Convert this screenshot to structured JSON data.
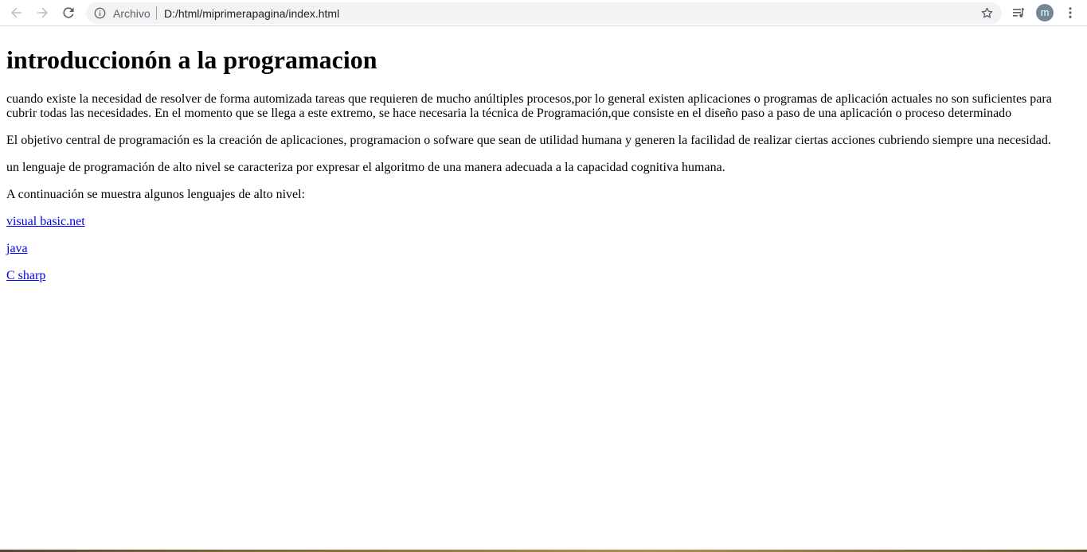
{
  "browser": {
    "address_scheme_label": "Archivo",
    "url": "D:/html/miprimerapagina/index.html",
    "profile_initial": "m",
    "icons": {
      "back": "arrow-left-icon",
      "forward": "arrow-right-icon",
      "reload": "reload-icon",
      "info": "info-icon",
      "bookmark": "star-icon",
      "media": "media-queue-icon",
      "menu": "kebab-menu-icon"
    },
    "colors": {
      "omnibox_bg": "#f1f3f4",
      "avatar_bg": "#6f8a96",
      "link": "#0000ee"
    }
  },
  "page": {
    "title": "introduccionón a la programacion",
    "paragraphs": [
      "cuando existe la necesidad de resolver de forma automizada tareas que requieren de mucho anúltiples procesos,por lo general existen aplicaciones o programas de aplicación actuales no son suficientes para cubrir todas las necesidades. En el momento que se llega a este extremo, se hace necesaria la técnica de Programación,que consiste en el diseño paso a paso de una aplicación o proceso determinado",
      "El objetivo central de programación es la creación de aplicaciones, programacion o sofware que sean de utilidad humana y generen la facilidad de realizar ciertas acciones cubriendo siempre una necesidad.",
      "un lenguaje de programación de alto nivel se caracteriza por expresar el algoritmo de una manera adecuada a la capacidad cognitiva humana.",
      "A continuación se muestra algunos lenguajes de alto nivel:"
    ],
    "links": [
      "visual basic.net",
      "java",
      "C sharp"
    ]
  }
}
